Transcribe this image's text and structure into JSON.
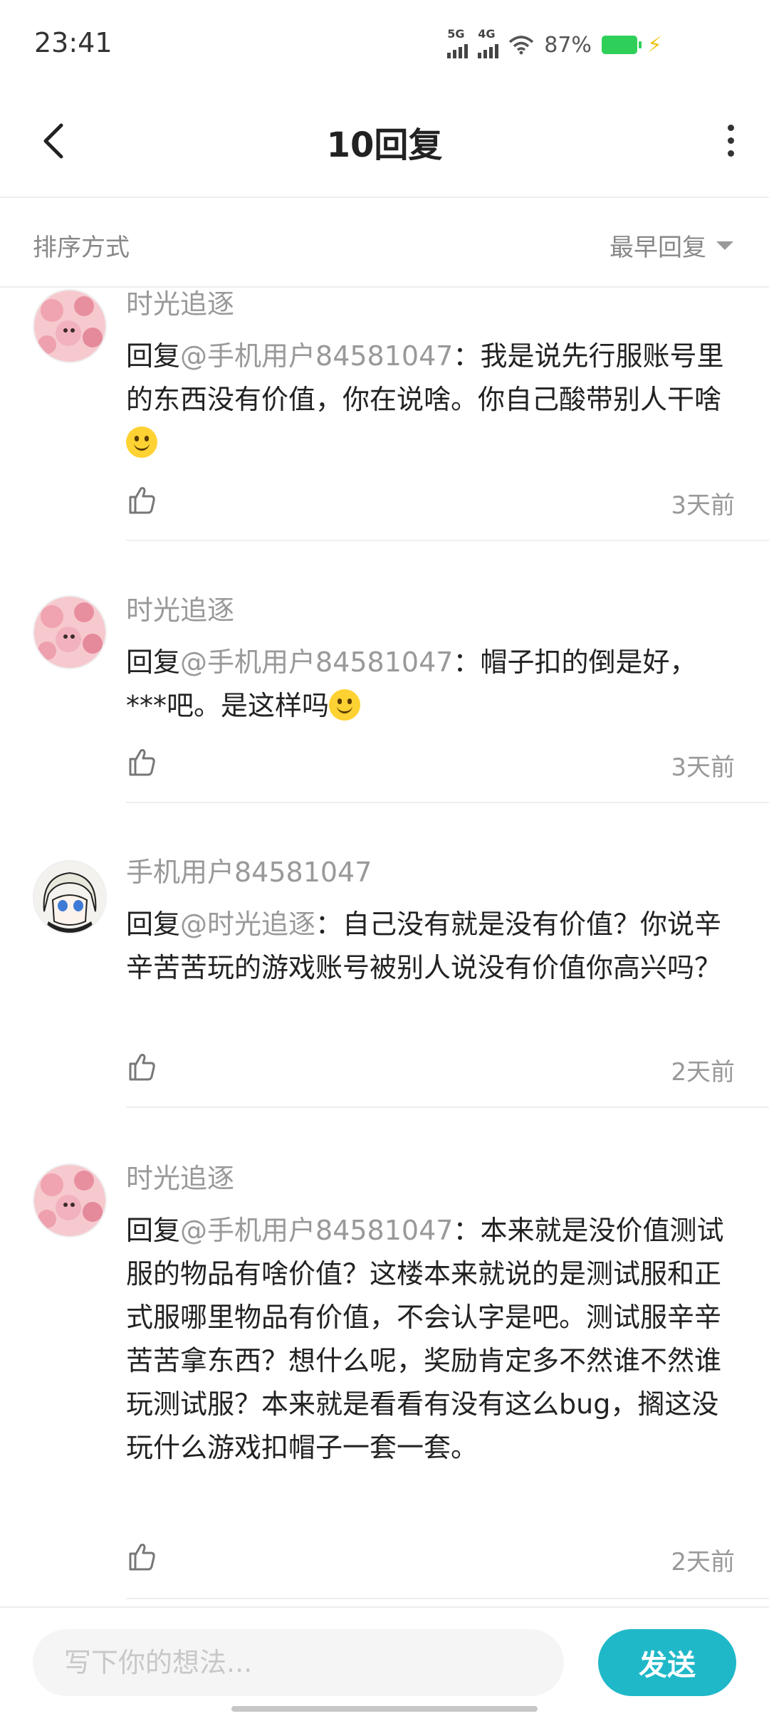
{
  "status": {
    "time": "23:41",
    "net1": "5G",
    "net2": "4G",
    "battery": "87%"
  },
  "header": {
    "title": "10回复"
  },
  "sort": {
    "label": "排序方式",
    "value": "最早回复"
  },
  "comments": [
    {
      "user": "时光追逐",
      "reply_prefix": "回复",
      "mention": "@手机用户84581047",
      "text": "：我是说先行服账号里的东西没有价值，你在说啥。你自己酸带别人干啥",
      "emoji": "slightly-smiling-face-icon",
      "time": "3天前",
      "avatar": "avatar-pink-hair"
    },
    {
      "user": "时光追逐",
      "reply_prefix": "回复",
      "mention": "@手机用户84581047",
      "text": "：帽子扣的倒是好，***吧。是这样吗",
      "emoji": "slightly-smiling-face-icon",
      "time": "3天前",
      "avatar": "avatar-pink-hair"
    },
    {
      "user": "手机用户84581047",
      "reply_prefix": "回复",
      "mention": "@时光追逐",
      "text": "：自己没有就是没有价值？你说辛辛苦苦玩的游戏账号被别人说没有价值你高兴吗？",
      "time": "2天前",
      "avatar": "avatar-white-hair"
    },
    {
      "user": "时光追逐",
      "reply_prefix": "回复",
      "mention": "@手机用户84581047",
      "text": "：本来就是没价值测试服的物品有啥价值？这楼本来就说的是测试服和正式服哪里物品有价值，不会认字是吧。测试服辛辛苦苦拿东西？想什么呢，奖励肯定多不然谁不然谁玩测试服？本来就是看看有没有这么bug，搁这没玩什么游戏扣帽子一套一套。",
      "time": "2天前",
      "avatar": "avatar-pink-hair"
    }
  ],
  "composer": {
    "placeholder": "写下你的想法...",
    "send_label": "发送"
  },
  "colors": {
    "accent": "#1fb8c8",
    "muted": "#999999"
  }
}
